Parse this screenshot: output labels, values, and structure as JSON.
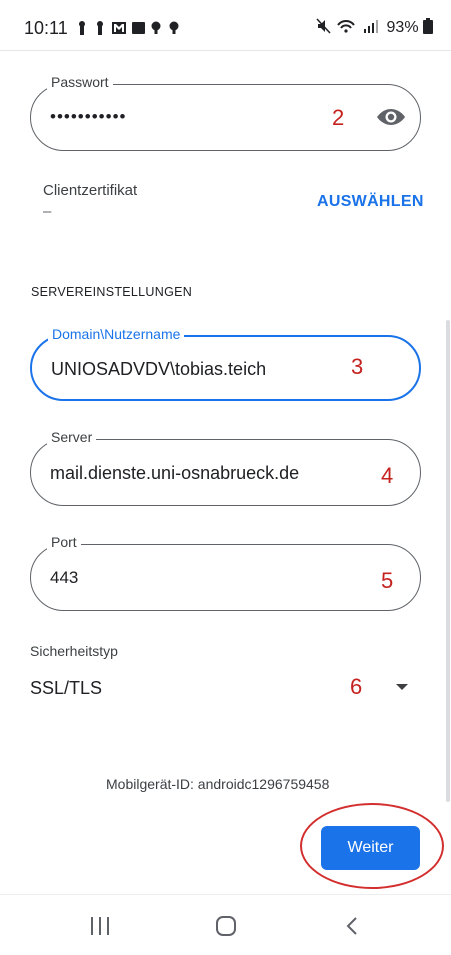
{
  "status": {
    "time": "10:11",
    "left_icons": "♟♟✉▣••",
    "right_icons": "🔇 ≡ ∥",
    "battery": "93%"
  },
  "password": {
    "label": "Passwort",
    "value": "•••••••••••",
    "annotation": "2"
  },
  "client_cert": {
    "label": "Clientzertifikat",
    "value": "–",
    "action": "AUSWÄHLEN"
  },
  "section_header": "SERVEREINSTELLUNGEN",
  "domain": {
    "label": "Domain\\Nutzername",
    "value": "UNIOSADVDV\\tobias.teich",
    "annotation": "3"
  },
  "server": {
    "label": "Server",
    "value": "mail.dienste.uni-osnabrueck.de",
    "annotation": "4"
  },
  "port": {
    "label": "Port",
    "value": "443",
    "annotation": "5"
  },
  "security": {
    "label": "Sicherheitstyp",
    "value": "SSL/TLS",
    "annotation": "6"
  },
  "device_id": "Mobilgerät-ID: androidc1296759458",
  "next_button": "Weiter",
  "colors": {
    "accent": "#1a73e8",
    "annotation": "#c5221f",
    "circle": "#d32f2f"
  }
}
